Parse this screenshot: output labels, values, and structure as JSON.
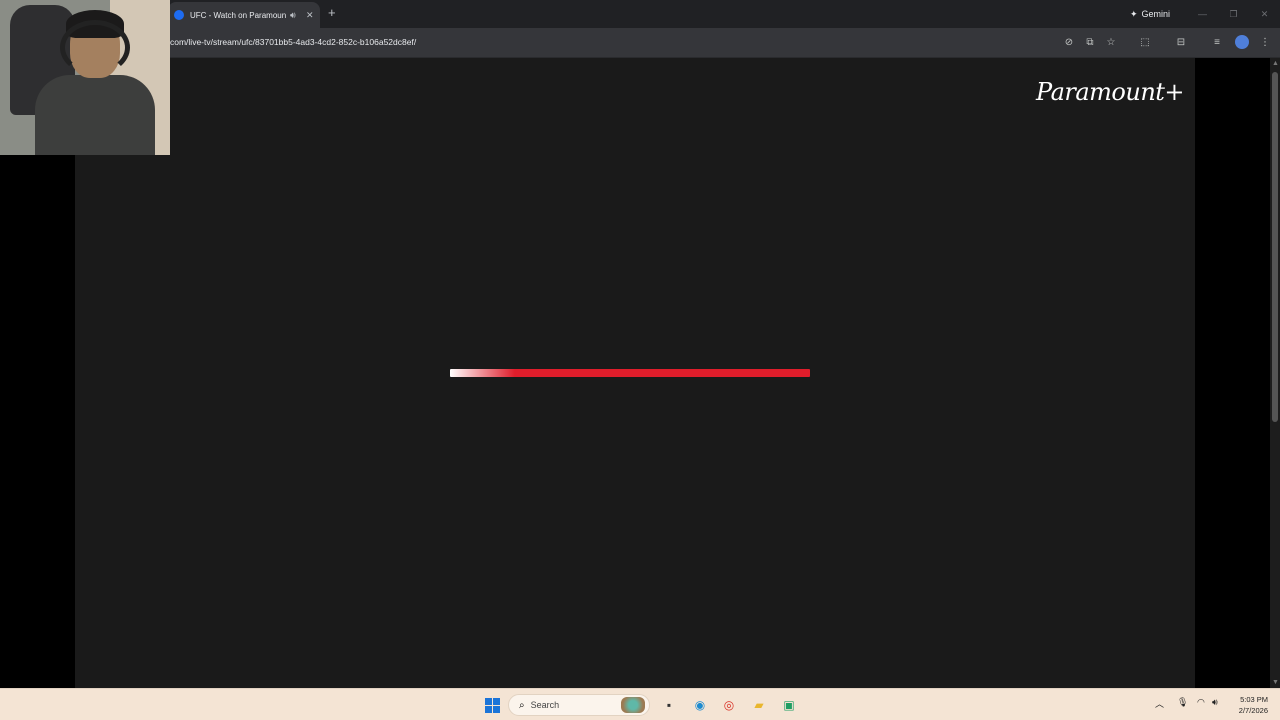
{
  "browser": {
    "tab": {
      "title": "UFC - Watch on Paramount+",
      "audio_icon": "speaker-icon",
      "close_icon": "close-icon"
    },
    "new_tab_icon": "plus-icon",
    "gemini_label": "Gemini",
    "window_controls": [
      "minimize-icon",
      "maximize-icon",
      "close-icon"
    ],
    "address_bar": {
      "url": "com/live-tv/stream/ufc/83701bb5-4ad3-4cd2-852c-b106a52dc8ef/"
    },
    "toolbar_icons": [
      "eye-slash-icon",
      "cast-icon",
      "bookmark-star-icon",
      "extensions-icon",
      "tab-search-icon",
      "reading-list-icon",
      "profile-avatar",
      "more-menu-icon"
    ]
  },
  "player": {
    "brand_logo_text": "Paramount+",
    "loader_progress": 1.0,
    "accent_color": "#e01d2b"
  },
  "taskbar": {
    "search_label": "Search",
    "pinned": [
      "windows-start-icon",
      "search-icon",
      "file-explorer-icon",
      "edge-icon",
      "chrome-icon",
      "folder-icon",
      "app-icon"
    ],
    "tray_icons": [
      "chevron-up-icon",
      "microphone-icon",
      "wifi-icon",
      "speaker-icon"
    ],
    "time": "5:03 PM",
    "date": "2/7/2026"
  }
}
